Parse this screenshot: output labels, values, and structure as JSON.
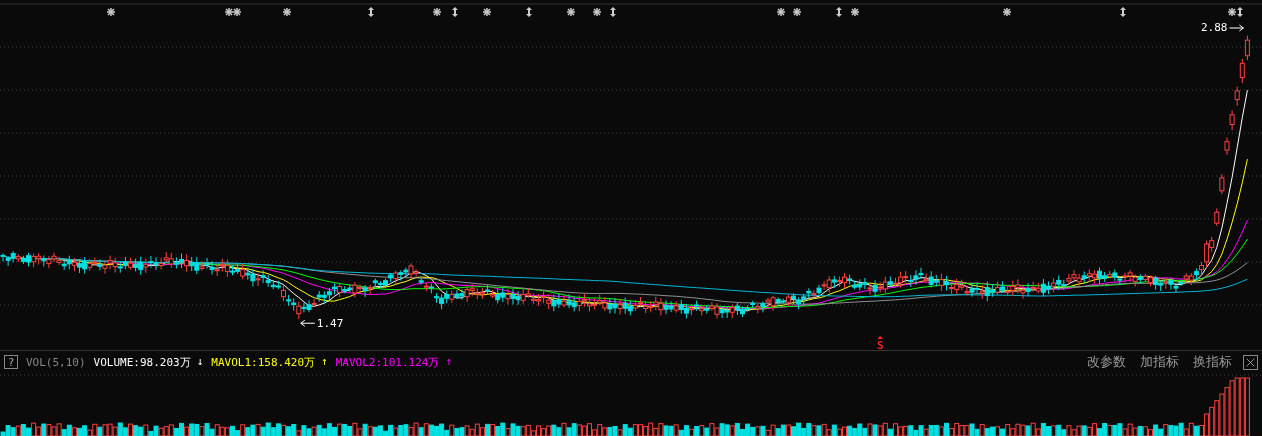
{
  "chart": {
    "top_markers": [
      {
        "kind": "star"
      },
      {
        "kind": "star"
      },
      {
        "kind": "star"
      },
      {
        "kind": "star"
      },
      {
        "kind": "updown"
      },
      {
        "kind": "star"
      },
      {
        "kind": "updown"
      },
      {
        "kind": "star"
      },
      {
        "kind": "updown"
      },
      {
        "kind": "star"
      },
      {
        "kind": "star"
      },
      {
        "kind": "updown"
      },
      {
        "kind": "star"
      },
      {
        "kind": "star"
      },
      {
        "kind": "updown"
      },
      {
        "kind": "star"
      },
      {
        "kind": "star"
      },
      {
        "kind": "updown"
      },
      {
        "kind": "star"
      },
      {
        "kind": "updown"
      }
    ],
    "high_label": "2.88",
    "low_label": "1.47",
    "signal": "S"
  },
  "volume_panel": {
    "help": "?",
    "indicator": "VOL(5,10)",
    "legend": [
      {
        "label": "VOLUME:98.203万",
        "arrow": "↓",
        "color": "#ffffff"
      },
      {
        "label": "MAVOL1:158.420万",
        "arrow": "↑",
        "color": "#ffff00"
      },
      {
        "label": "MAVOL2:101.124万",
        "arrow": "↑",
        "color": "#ff00ff"
      }
    ],
    "buttons": [
      "改参数",
      "加指标",
      "换指标"
    ]
  }
}
